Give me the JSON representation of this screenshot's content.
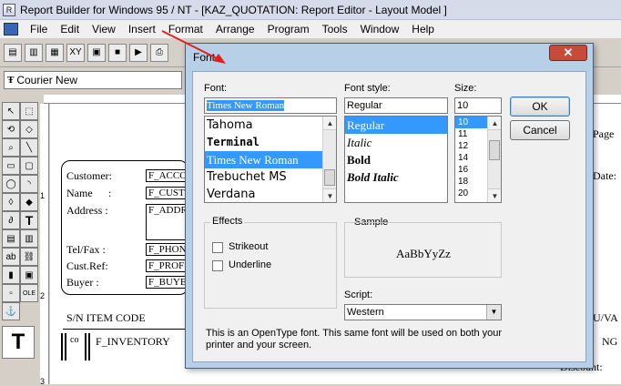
{
  "app": {
    "title": "Report Builder for Windows 95 / NT - [KAZ_QUOTATION: Report Editor - Layout Model ]",
    "menu": [
      "File",
      "Edit",
      "View",
      "Insert",
      "Format",
      "Arrange",
      "Program",
      "Tools",
      "Window",
      "Help"
    ],
    "font_combo_value": "Courier New"
  },
  "report": {
    "labels": {
      "customer": "Customer:",
      "name": "Name",
      "address": "Address :",
      "telfax": "Tel/Fax :",
      "custref": "Cust.Ref:",
      "buyer": "Buyer :",
      "sn_item": "S/N  ITEM CODE",
      "page": "Page",
      "date": "Date:",
      "uva": "U/VA",
      "discount": "Discount:",
      "ng": "NG"
    },
    "fields": {
      "acc": "F_ACCO",
      "cust": "F_CUST",
      "addr": "F_ADDR",
      "phon": "F_PHON",
      "prof": "F_PROF",
      "buy": "F_BUYE",
      "inventory": "F_INVENTORY"
    },
    "ruler_left": [
      "1",
      "2",
      "3"
    ]
  },
  "dialog": {
    "title": "Font",
    "font_label": "Font:",
    "font_value": "Times New Roman",
    "fonts": [
      "Tahoma",
      "Terminal",
      "Times New Roman",
      "Trebuchet MS",
      "Verdana"
    ],
    "selected_font_index": 2,
    "style_label": "Font style:",
    "style_value": "Regular",
    "styles": [
      "Regular",
      "Italic",
      "Bold",
      "Bold Italic"
    ],
    "selected_style_index": 0,
    "size_label": "Size:",
    "size_value": "10",
    "sizes": [
      "10",
      "11",
      "12",
      "14",
      "16",
      "18",
      "20"
    ],
    "selected_size_index": 0,
    "ok_label": "OK",
    "cancel_label": "Cancel",
    "effects_label": "Effects",
    "strikeout_label": "Strikeout",
    "underline_label": "Underline",
    "strikeout_checked": false,
    "underline_checked": false,
    "sample_label": "Sample",
    "sample_text": "AaBbYyZz",
    "script_label": "Script:",
    "script_value": "Western",
    "info_line1": "This is an OpenType font. This same font will be used on both your",
    "info_line2": "printer and your screen.",
    "close_glyph": "✕"
  },
  "colors": {
    "selection": "#3399ff",
    "dialog_frame": "#b8cfe8",
    "close_button": "#c74b3a",
    "annotation_arrow": "#e0201a"
  }
}
